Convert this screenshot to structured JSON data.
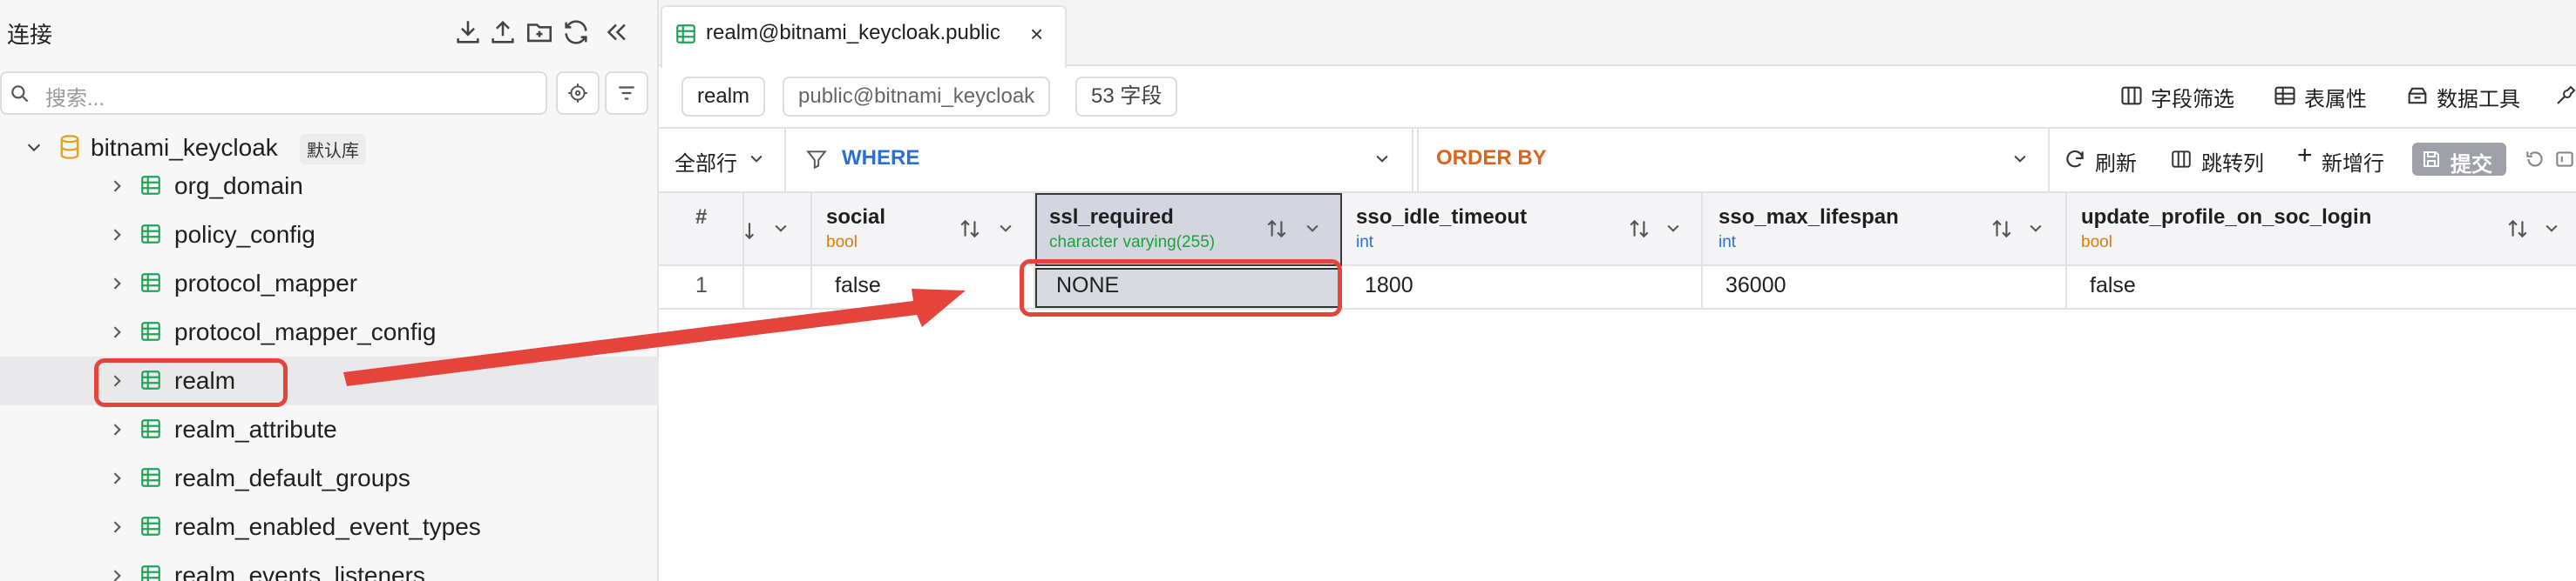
{
  "sidebar": {
    "title": "连接",
    "search_placeholder": "搜索...",
    "database": {
      "name": "bitnami_keycloak",
      "badge": "默认库"
    },
    "tables": [
      "org_domain",
      "policy_config",
      "protocol_mapper",
      "protocol_mapper_config",
      "realm",
      "realm_attribute",
      "realm_default_groups",
      "realm_enabled_event_types",
      "realm_events_listeners"
    ],
    "selected_table": "realm"
  },
  "tab": {
    "label": "realm@bitnami_keycloak.public",
    "close": "×"
  },
  "toolbar": {
    "table_chip": "realm",
    "schema_chip": "public@bitnami_keycloak",
    "fields_chip": "53 字段",
    "field_filter": "字段筛选",
    "table_props": "表属性",
    "data_tools": "数据工具"
  },
  "query_bar": {
    "rows": "全部行",
    "where": "WHERE",
    "order_by": "ORDER BY",
    "refresh": "刷新",
    "jump_col": "跳转列",
    "add_row": "新增行",
    "submit": "提交"
  },
  "grid": {
    "row_header": "#",
    "columns": [
      {
        "name": "social",
        "type": "bool"
      },
      {
        "name": "ssl_required",
        "type": "character varying(255)"
      },
      {
        "name": "sso_idle_timeout",
        "type": "int"
      },
      {
        "name": "sso_max_lifespan",
        "type": "int"
      },
      {
        "name": "update_profile_on_soc_login",
        "type": "bool"
      }
    ],
    "rows": [
      {
        "num": "1",
        "cells": [
          "false",
          "NONE",
          "1800",
          "36000",
          "false"
        ]
      }
    ]
  },
  "colors": {
    "accent_red": "#e5443d",
    "bool_type": "#e07b00",
    "varchar_type": "#1aa33b",
    "int_type": "#2d6fd6",
    "where_blue": "#2d6fd6",
    "order_orange": "#d9661e",
    "table_icon_green": "#22a35a"
  }
}
